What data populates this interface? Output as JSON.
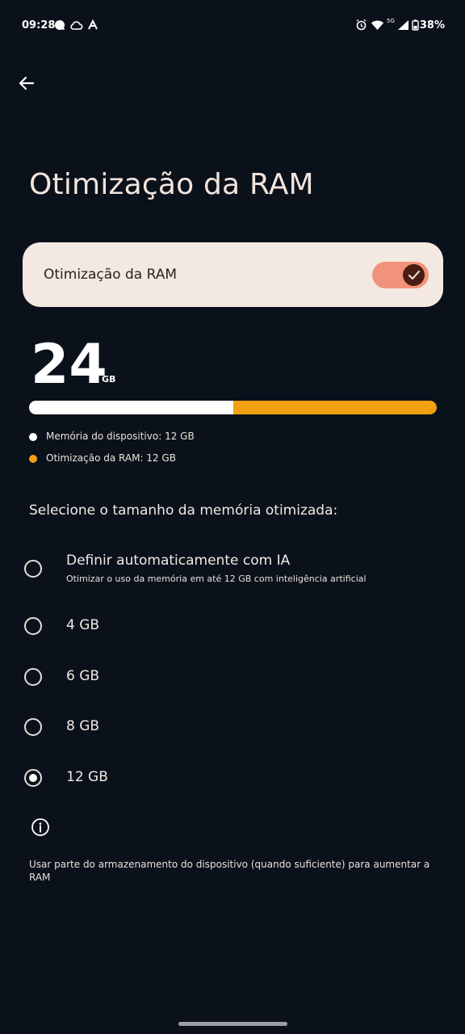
{
  "status_bar": {
    "time": "09:28",
    "battery": "38%",
    "network": "5G",
    "icons": [
      "chat-bubble-icon",
      "cloud-icon",
      "a-icon",
      "alarm-icon",
      "wifi-icon",
      "signal-icon",
      "battery-icon"
    ]
  },
  "header": {
    "back_icon": "arrow-left-icon",
    "title": "Otimização da RAM"
  },
  "toggle_card": {
    "label": "Otimização da RAM",
    "enabled": true,
    "knob_icon": "check-icon"
  },
  "memory": {
    "total_value": "24",
    "unit": "GB",
    "device_fraction": 0.5,
    "legend": [
      {
        "label": "Memória do dispositivo: 12 GB",
        "color": "#ffffff"
      },
      {
        "label": "Otimização da RAM: 12 GB",
        "color": "#f0a012"
      }
    ]
  },
  "selection": {
    "heading": "Selecione o tamanho da memória otimizada:",
    "options": [
      {
        "label": "Definir automaticamente com IA",
        "sub": "Otimizar o uso da memória em até 12 GB com inteligência artificial",
        "checked": false
      },
      {
        "label": "4 GB",
        "checked": false
      },
      {
        "label": "6 GB",
        "checked": false
      },
      {
        "label": "8 GB",
        "checked": false
      },
      {
        "label": "12 GB",
        "checked": true
      }
    ]
  },
  "info": {
    "icon": "info-icon",
    "text": "Usar parte do armazenamento do dispositivo (quando suficiente) para aumentar a RAM"
  },
  "colors": {
    "background": "#0b111a",
    "card": "#f3e8e2",
    "accent": "#f0a012",
    "toggle_track": "#f1937a",
    "toggle_knob": "#4a1c14"
  }
}
